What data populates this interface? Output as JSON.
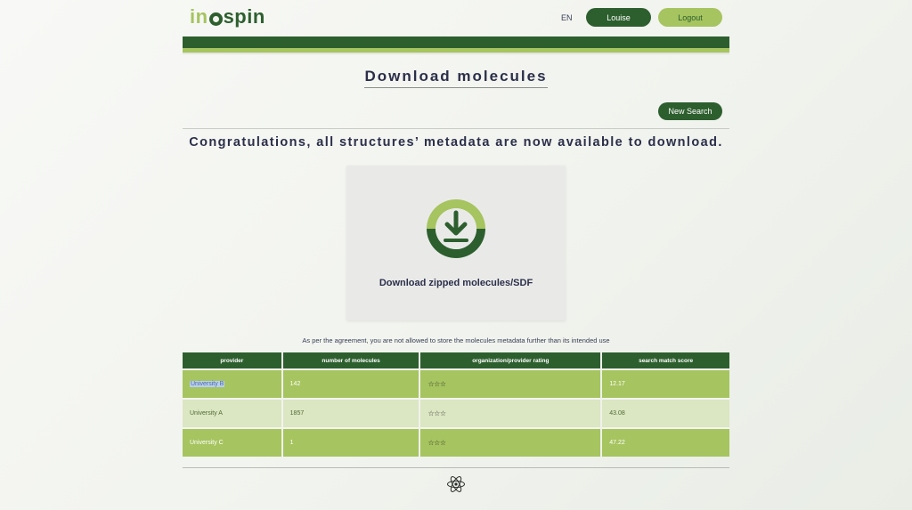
{
  "header": {
    "logo": {
      "part1": "in",
      "part2": "spin"
    },
    "language": "EN",
    "user_button": "Louise",
    "logout_button": "Logout"
  },
  "page": {
    "title": "Download molecules",
    "new_search_button": "New Search",
    "congrats_message": "Congratulations, all structures’ metadata are now available to download.",
    "download_label": "Download zipped molecules/SDF",
    "notice": "As per the agreement, you are not allowed to store the molecules metadata further than its intended use"
  },
  "table": {
    "columns": [
      "provider",
      "number of molecules",
      "organization/provider rating",
      "search match score"
    ],
    "rows": [
      {
        "provider": "University B",
        "count": "142",
        "rating": "☆☆☆",
        "score": "12.17"
      },
      {
        "provider": "University A",
        "count": "1857",
        "rating": "☆☆☆",
        "score": "43.08"
      },
      {
        "provider": "University C",
        "count": "1",
        "rating": "☆☆☆",
        "score": "47.22"
      }
    ]
  },
  "colors": {
    "dark_green": "#2d5f2e",
    "light_green": "#a6c45f",
    "pale_green": "#dbe6c2",
    "text_navy": "#2b2f4a"
  },
  "icons": [
    "download-icon",
    "atom-icon"
  ]
}
